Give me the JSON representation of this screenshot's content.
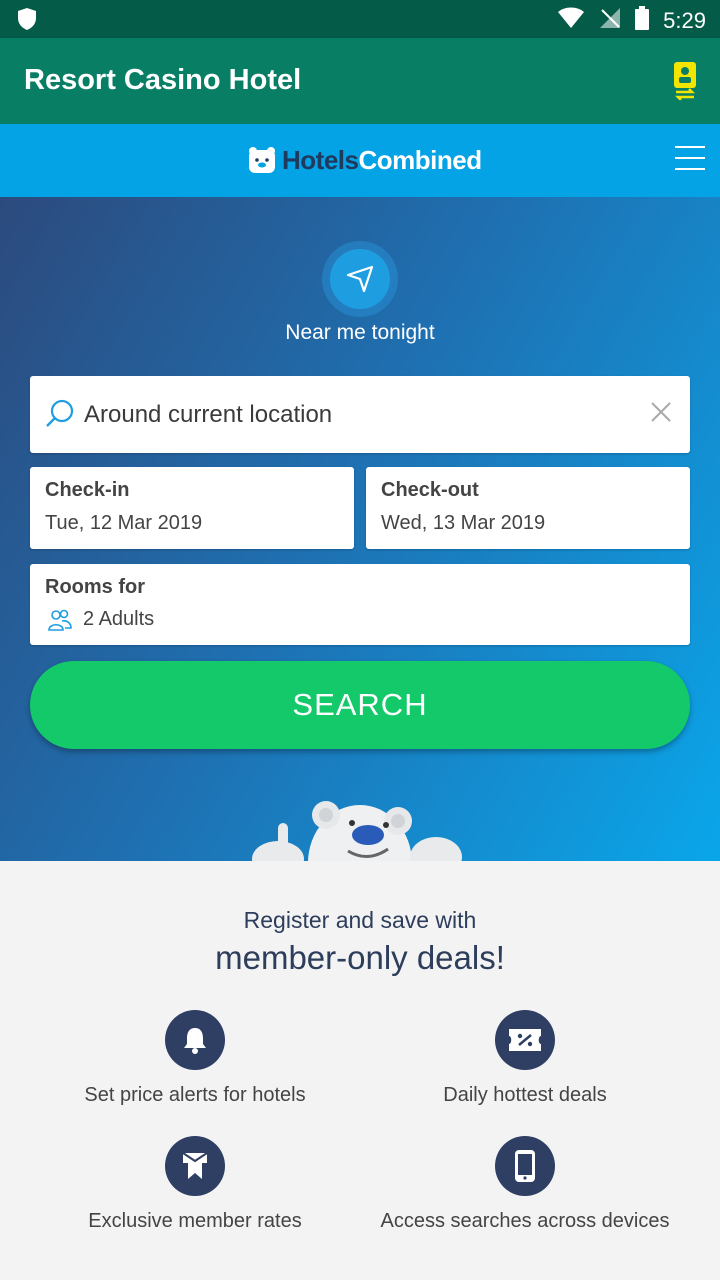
{
  "status_bar": {
    "time": "5:29",
    "icons": [
      "shield-icon",
      "wifi-icon",
      "no-signal-icon",
      "battery-icon"
    ]
  },
  "app_bar": {
    "title": "Resort Casino Hotel",
    "switch_icon": "phone-switch-icon"
  },
  "header": {
    "logo_part1": "Hotels",
    "logo_part2": "Combined",
    "menu_icon": "hamburger-menu-icon"
  },
  "hero": {
    "near_me_label": "Near me tonight",
    "location": {
      "value": "Around current location"
    },
    "checkin": {
      "label": "Check-in",
      "value": "Tue, 12 Mar 2019"
    },
    "checkout": {
      "label": "Check-out",
      "value": "Wed, 13 Mar 2019"
    },
    "rooms": {
      "label": "Rooms for",
      "value": "2 Adults"
    },
    "search_label": "SEARCH"
  },
  "promo": {
    "line1": "Register and save with",
    "line2": "member-only deals!",
    "features": [
      {
        "label": "Set price alerts for hotels",
        "icon": "bell-icon"
      },
      {
        "label": "Daily hottest deals",
        "icon": "discount-ticket-icon"
      },
      {
        "label": "Exclusive member rates",
        "icon": "ribbon-icon"
      },
      {
        "label": "Access searches across devices",
        "icon": "mobile-device-icon"
      }
    ]
  },
  "colors": {
    "status_bar": "#045c48",
    "app_bar": "#087f65",
    "header": "#03a3e6",
    "search_button": "#14c96a",
    "feature_icon_bg": "#2e3f63"
  }
}
